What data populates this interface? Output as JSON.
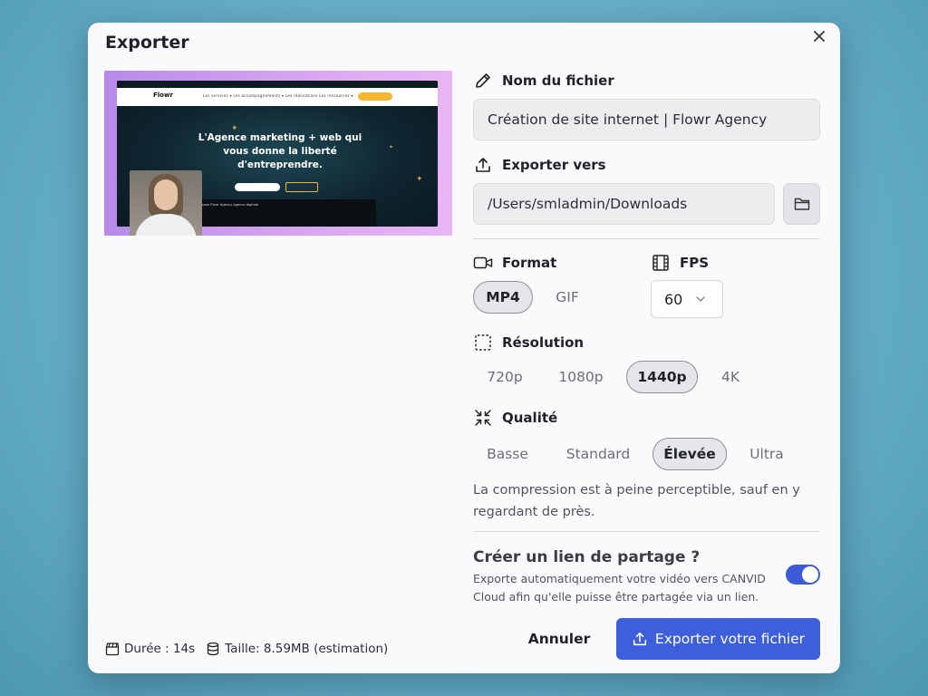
{
  "dialog": {
    "title": "Exporter"
  },
  "preview": {
    "headline_line1": "L'Agence marketing + web qui",
    "headline_line2": "vous donne la liberté",
    "headline_line3": "d'entreprendre.",
    "logo": "Flowr",
    "nav_links": "Les services ▾   Les accompagnements ▾   Les réalisations   Les ressources ▾",
    "video_caption": "Showcase Flowr Agency agence digitale"
  },
  "filename": {
    "label": "Nom du fichier",
    "value": "Création de site internet | Flowr Agency"
  },
  "export_to": {
    "label": "Exporter vers",
    "value": "/Users/smladmin/Downloads"
  },
  "format": {
    "label": "Format",
    "options": [
      "MP4",
      "GIF"
    ],
    "selected": "MP4"
  },
  "fps": {
    "label": "FPS",
    "value": "60"
  },
  "resolution": {
    "label": "Résolution",
    "options": [
      "720p",
      "1080p",
      "1440p",
      "4K"
    ],
    "selected": "1440p"
  },
  "quality": {
    "label": "Qualité",
    "options": [
      "Basse",
      "Standard",
      "Élevée",
      "Ultra"
    ],
    "selected": "Élevée",
    "description": "La compression est à peine perceptible, sauf en y regardant de près."
  },
  "share": {
    "title": "Créer un lien de partage ?",
    "description": "Exporte automatiquement votre vidéo vers CANVID Cloud afin qu'elle puisse être partagée via un lien.",
    "enabled": true
  },
  "footer": {
    "duration": "Durée : 14s",
    "size": "Taille: 8.59MB (estimation)",
    "cancel_label": "Annuler",
    "export_label": "Exporter votre fichier"
  },
  "colors": {
    "accent": "#3e5fdc",
    "background": "#6fb3cc"
  },
  "icons": {
    "close": "close-icon",
    "filename": "pencil-icon",
    "export_to": "upload-icon",
    "folder": "folder-icon",
    "format": "video-camera-icon",
    "fps": "film-icon",
    "resolution": "dashed-square-icon",
    "quality": "compress-arrows-icon",
    "duration": "clapperboard-icon",
    "size": "database-icon",
    "export_button": "upload-icon"
  }
}
